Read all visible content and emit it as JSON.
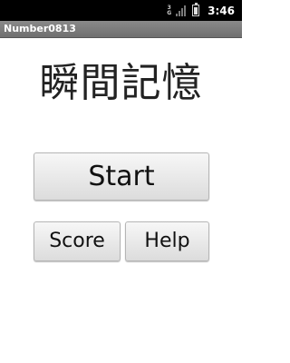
{
  "status_bar": {
    "network_type": [
      "3",
      "G"
    ],
    "time": "3:46"
  },
  "window": {
    "title": "Number0813"
  },
  "main": {
    "app_title": "瞬間記憶",
    "buttons": {
      "start": "Start",
      "score": "Score",
      "help": "Help"
    }
  },
  "colors": {
    "status_bar_bg": "#000000",
    "title_bar_bg": "#7d7d7d",
    "button_bg": "#e8e8e8",
    "text": "#222222"
  }
}
